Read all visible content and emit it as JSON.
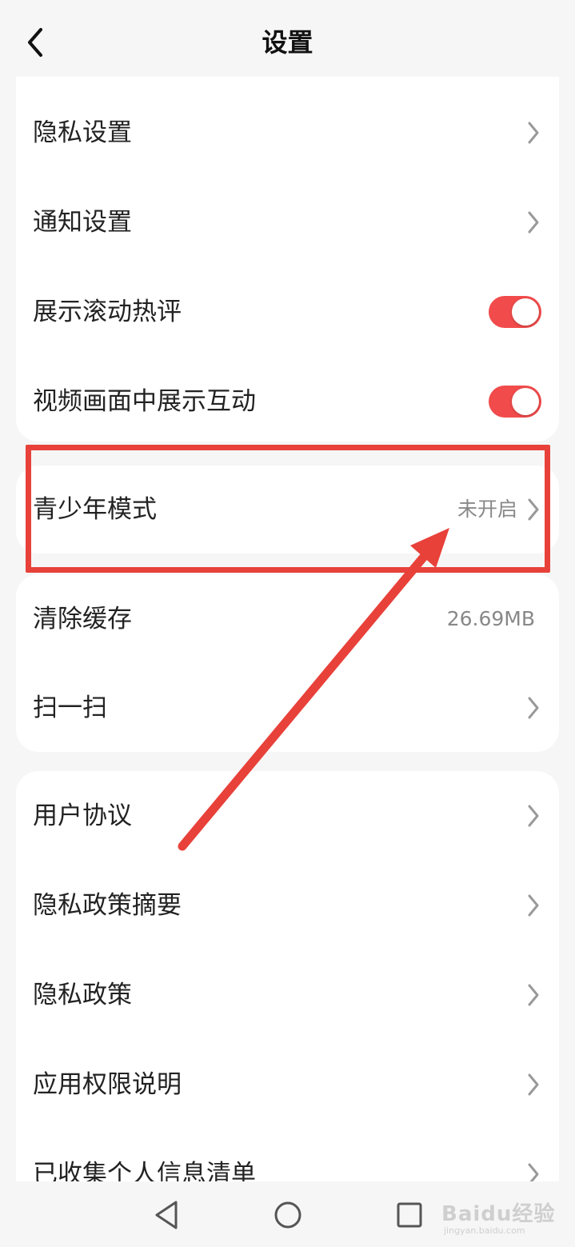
{
  "header": {
    "title": "设置"
  },
  "group1": {
    "items": [
      {
        "label": "隐私设置"
      },
      {
        "label": "通知设置"
      },
      {
        "label": "展示滚动热评",
        "toggle_on": true
      },
      {
        "label": "视频画面中展示互动",
        "toggle_on": true
      }
    ]
  },
  "teen_mode": {
    "label": "青少年模式",
    "value": "未开启"
  },
  "group2": {
    "items": [
      {
        "label": "清除缓存",
        "value": "26.69MB"
      },
      {
        "label": "扫一扫"
      }
    ]
  },
  "group3": {
    "items": [
      {
        "label": "用户协议"
      },
      {
        "label": "隐私政策摘要"
      },
      {
        "label": "隐私政策"
      },
      {
        "label": "应用权限说明"
      },
      {
        "label": "已收集个人信息清单"
      }
    ]
  },
  "annotation": {
    "color": "#e8413a"
  },
  "colors": {
    "toggle_on": "#f24b4b",
    "background": "#f6f6f6"
  },
  "watermark": {
    "text": "Baidu经验",
    "sub": "jingyan.baidu.com"
  }
}
